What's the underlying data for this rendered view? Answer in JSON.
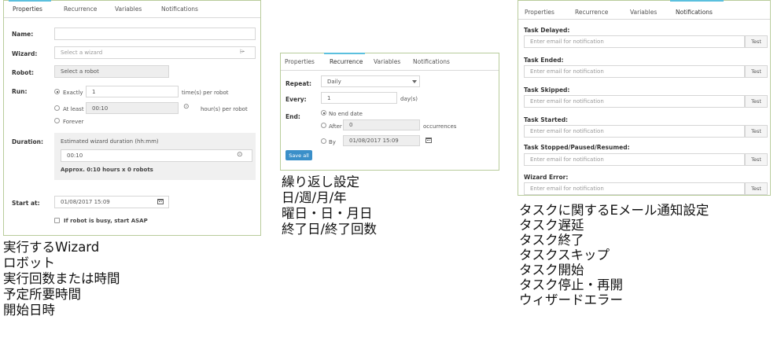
{
  "tabs": [
    "Properties",
    "Recurrence",
    "Variables",
    "Notifications"
  ],
  "panel1": {
    "name_label": "Name:",
    "wizard_label": "Wizard:",
    "wizard_placeholder": "Select a wizard",
    "robot_label": "Robot:",
    "robot_value": "Select a robot",
    "run_label": "Run:",
    "exactly_label": "Exactly",
    "exactly_value": "1",
    "exactly_unit": "time(s) per robot",
    "atleast_label": "At least",
    "atleast_value": "00:10",
    "atleast_unit": "hour(s) per robot",
    "forever_label": "Forever",
    "duration_label": "Duration:",
    "duration_title": "Estimated wizard duration (hh:mm)",
    "duration_value": "00:10",
    "duration_approx": "Approx. 0:10 hours x 0 robots",
    "start_label": "Start at:",
    "start_value": "01/08/2017 15:09",
    "asap_label": "If robot is busy, start ASAP"
  },
  "panel2": {
    "repeat_label": "Repeat:",
    "repeat_value": "Daily",
    "every_label": "Every:",
    "every_value": "1",
    "every_unit": "day(s)",
    "end_label": "End:",
    "no_end_label": "No end date",
    "after_label": "After",
    "after_value": "0",
    "after_unit": "occurrences",
    "by_label": "By",
    "by_value": "01/08/2017 15:09",
    "save_label": "Save all"
  },
  "panel3": {
    "placeholder": "Enter email for notification",
    "test_label": "Test",
    "rows": [
      {
        "label": "Task Delayed:"
      },
      {
        "label": "Task Ended:"
      },
      {
        "label": "Task Skipped:"
      },
      {
        "label": "Task Started:"
      },
      {
        "label": "Task Stopped/Paused/Resumed:"
      },
      {
        "label": "Wizard Error:"
      }
    ]
  },
  "captions": {
    "left": [
      "実行するWizard",
      "ロボット",
      "実行回数または時間",
      "予定所要時間",
      "開始日時"
    ],
    "middle": [
      "繰り返し設定",
      "日/週/月/年",
      "曜日・日・月日",
      "終了日/終了回数"
    ],
    "right": [
      "タスクに関するEメール通知設定",
      "タスク遅延",
      "タスク終了",
      "タスクスキップ",
      "タスク開始",
      "タスク停止・再開",
      "ウィザードエラー"
    ]
  }
}
